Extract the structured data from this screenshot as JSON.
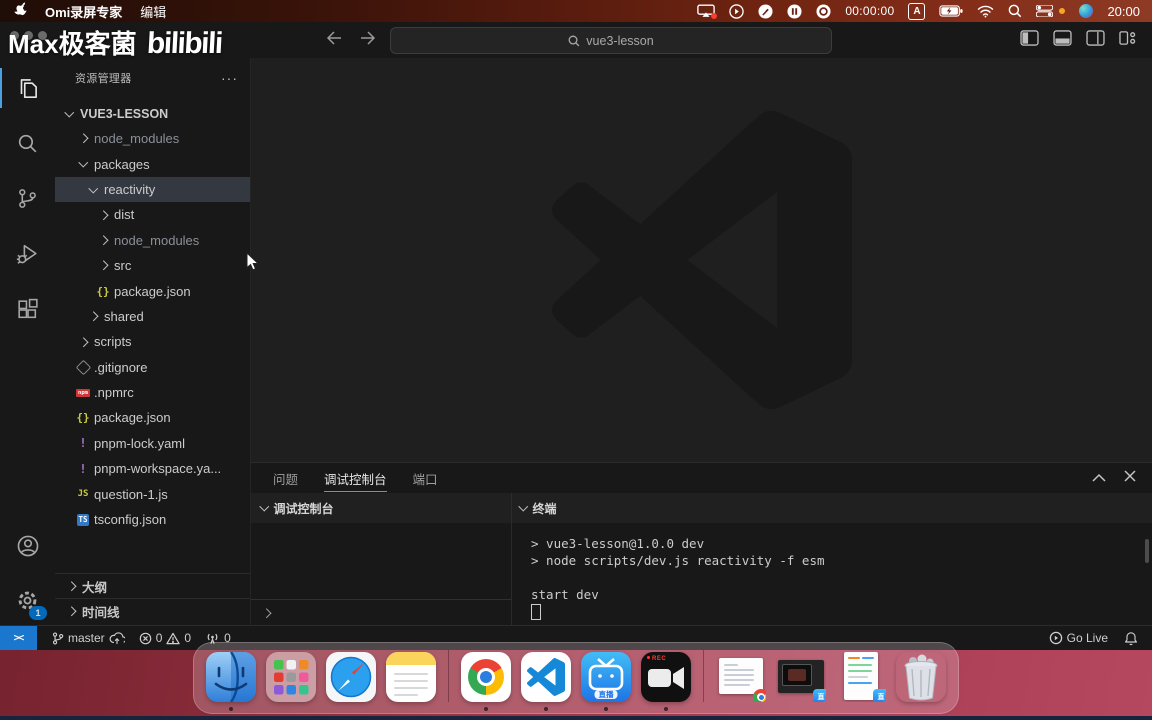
{
  "colors": {
    "accent": "#0078d4",
    "tab_underline": "#4a9edd",
    "statusbar_remote": "#1b76cd",
    "menubar_red": "#7c2917",
    "wallpaper_rose": "#a63a50",
    "npm_red": "#cb3837",
    "json_yellow": "#cbcb41",
    "yaml_purple": "#a074c4",
    "ts_blue": "#3178c6"
  },
  "menubar": {
    "app_name": "Omi录屏专家",
    "menu_edit": "编辑",
    "recording_timer": "00:00:00",
    "input_method": "A",
    "clock": "20:00"
  },
  "watermark": {
    "author": "Max极客菌",
    "brand": "bilibili"
  },
  "titlebar": {
    "search_value": "vue3-lesson"
  },
  "activity_bar": {
    "settings_badge": "1",
    "icons": [
      "files-explorer",
      "search",
      "source-control",
      "run-and-debug",
      "extensions",
      "account",
      "settings-gear"
    ]
  },
  "explorer": {
    "title": "资源管理器",
    "more_label": "···",
    "root": "VUE3-LESSON",
    "tree": [
      {
        "label": "node_modules",
        "depth": 1,
        "kind": "folder",
        "expanded": false,
        "dim": true
      },
      {
        "label": "packages",
        "depth": 1,
        "kind": "folder",
        "expanded": true
      },
      {
        "label": "reactivity",
        "depth": 2,
        "kind": "folder",
        "expanded": true,
        "selected": true
      },
      {
        "label": "dist",
        "depth": 3,
        "kind": "folder",
        "expanded": false
      },
      {
        "label": "node_modules",
        "depth": 3,
        "kind": "folder",
        "expanded": false,
        "dim": true
      },
      {
        "label": "src",
        "depth": 3,
        "kind": "folder",
        "expanded": false
      },
      {
        "label": "package.json",
        "depth": 3,
        "kind": "file",
        "icon": "json"
      },
      {
        "label": "shared",
        "depth": 2,
        "kind": "folder",
        "expanded": false
      },
      {
        "label": "scripts",
        "depth": 1,
        "kind": "folder",
        "expanded": false
      },
      {
        "label": ".gitignore",
        "depth": 1,
        "kind": "file",
        "icon": "git"
      },
      {
        "label": ".npmrc",
        "depth": 1,
        "kind": "file",
        "icon": "npm"
      },
      {
        "label": "package.json",
        "depth": 1,
        "kind": "file",
        "icon": "json"
      },
      {
        "label": "pnpm-lock.yaml",
        "depth": 1,
        "kind": "file",
        "icon": "yaml"
      },
      {
        "label": "pnpm-workspace.ya...",
        "depth": 1,
        "kind": "file",
        "icon": "yaml"
      },
      {
        "label": "question-1.js",
        "depth": 1,
        "kind": "file",
        "icon": "js"
      },
      {
        "label": "tsconfig.json",
        "depth": 1,
        "kind": "file",
        "icon": "ts"
      }
    ],
    "outline_label": "大纲",
    "timeline_label": "时间线"
  },
  "panel": {
    "tabs": [
      {
        "label": "问题",
        "active": false
      },
      {
        "label": "调试控制台",
        "active": true
      },
      {
        "label": "端口",
        "active": false
      }
    ],
    "debug_console": {
      "header": "调试控制台"
    },
    "terminal": {
      "header": "终端",
      "lines": [
        "> vue3-lesson@1.0.0 dev",
        "> node scripts/dev.js reactivity -f esm",
        "",
        "start dev"
      ]
    }
  },
  "status_bar": {
    "branch": "master",
    "errors": "0",
    "warnings": "0",
    "ports": "0",
    "go_live": "Go Live"
  },
  "dock": {
    "items": [
      {
        "name": "finder",
        "running": true
      },
      {
        "name": "launchpad",
        "running": false
      },
      {
        "name": "safari",
        "running": false
      },
      {
        "name": "notes",
        "running": false
      },
      {
        "divider": true
      },
      {
        "name": "chrome",
        "running": true
      },
      {
        "name": "vscode",
        "running": true
      },
      {
        "name": "bilibili-live",
        "label": "直播",
        "running": true
      },
      {
        "name": "screen-recorder",
        "label": "REC",
        "running": true
      },
      {
        "divider": true
      },
      {
        "name": "minimized-chrome-window",
        "running": false
      },
      {
        "name": "minimized-live-window",
        "badge": "直",
        "running": false
      },
      {
        "name": "minimized-notes-window",
        "badge": "直",
        "running": false
      },
      {
        "name": "trash-full",
        "running": false
      }
    ]
  }
}
